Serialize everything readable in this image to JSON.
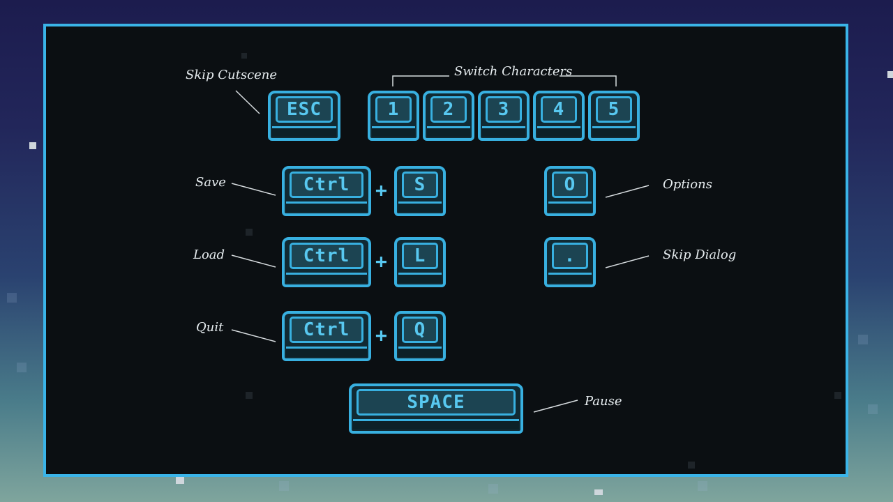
{
  "labels": {
    "skip_cutscene": "Skip Cutscene",
    "switch_characters": "Switch Characters",
    "save": "Save",
    "load": "Load",
    "quit": "Quit",
    "options": "Options",
    "skip_dialog": "Skip Dialog",
    "pause": "Pause"
  },
  "keys": {
    "esc": "ESC",
    "n1": "1",
    "n2": "2",
    "n3": "3",
    "n4": "4",
    "n5": "5",
    "ctrl_save": "Ctrl",
    "s": "S",
    "ctrl_load": "Ctrl",
    "l": "L",
    "ctrl_quit": "Ctrl",
    "q": "Q",
    "o": "O",
    "period": ".",
    "space": "SPACE"
  },
  "plus": "+",
  "colors": {
    "accent": "#38b0e0",
    "panel": "#0b0f12",
    "label": "#e6ecef"
  }
}
